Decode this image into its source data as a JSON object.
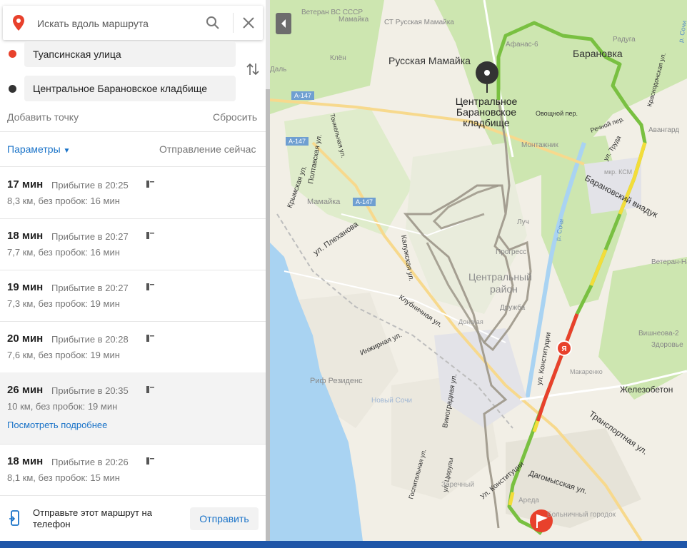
{
  "search": {
    "placeholder": "Искать вдоль маршрута"
  },
  "waypoints": [
    {
      "label": "Туапсинская улица",
      "color": "#e8412c"
    },
    {
      "label": "Центральное Барановское кладбище",
      "color": "#333333"
    }
  ],
  "actions": {
    "add_point": "Добавить точку",
    "reset": "Сбросить",
    "params": "Параметры",
    "departure": "Отправление сейчас"
  },
  "routes": [
    {
      "duration": "17 мин",
      "arrival": "Прибытие в 20:25",
      "distance": "8,3 км, без пробок: 16 мин"
    },
    {
      "duration": "18 мин",
      "arrival": "Прибытие в 20:27",
      "distance": "7,7 км, без пробок: 16 мин"
    },
    {
      "duration": "19 мин",
      "arrival": "Прибытие в 20:27",
      "distance": "7,3 км, без пробок: 19 мин"
    },
    {
      "duration": "20 мин",
      "arrival": "Прибытие в 20:28",
      "distance": "7,6 км, без пробок: 19 мин"
    },
    {
      "duration": "26 мин",
      "arrival": "Прибытие в 20:35",
      "distance": "10 км, без пробок: 19 мин",
      "more": "Посмотреть подробнее"
    },
    {
      "duration": "18 мин",
      "arrival": "Прибытие в 20:26",
      "distance": "8,1 км, без пробок: 15 мин"
    }
  ],
  "send": {
    "text": "Отправьте этот маршрут на телефон",
    "button": "Отправить"
  },
  "map": {
    "dest_label": [
      "Центральное",
      "Барановское",
      "кладбище"
    ],
    "places": [
      "Русская Мамайка",
      "Барановка",
      "Мамайка",
      "Центральный",
      "район",
      "Железобетон",
      "Транспортная ул.",
      "Барановский виадук",
      "Риф Резиденс",
      "Новый Сочи",
      "Заречный",
      "Дагомысская ул.",
      "ул. Конституции",
      "ул. Плеханова",
      "Клубничная ул.",
      "Инжирная ул.",
      "Калужская ул.",
      "Виноградная ул.",
      "Полтавская ул.",
      "Крымская ул.",
      "Тоннельная ул.",
      "Госпитальная ул.",
      "ул. Цюрупы",
      "Прогресс",
      "Дружба",
      "Луч",
      "Монтажник",
      "Овощной пер.",
      "Речной пер.",
      "Авангард",
      "Краснодонская ул.",
      "мкр. КСМ",
      "Радуга",
      "Ветеран ВС СССР",
      "Мамайка",
      "СТ Русская Мамайка",
      "Клён",
      "Даль",
      "Афанас-6",
      "Вишнеова-2",
      "Здоровье",
      "Ветеран-Нагорный",
      "Макаренко",
      "Донская",
      "Ареда",
      "Больничный городок",
      "ул. Труда",
      "р. Сочи",
      "Ул. Конституции",
      "р. Сочи",
      "А-147"
    ],
    "colors": {
      "water": "#a9d3f2",
      "green": "#c8e6a8",
      "route_main": "#79c041",
      "route_alt": "#9c9688",
      "jam": "#e8412c",
      "slow": "#f3dd3a"
    }
  }
}
